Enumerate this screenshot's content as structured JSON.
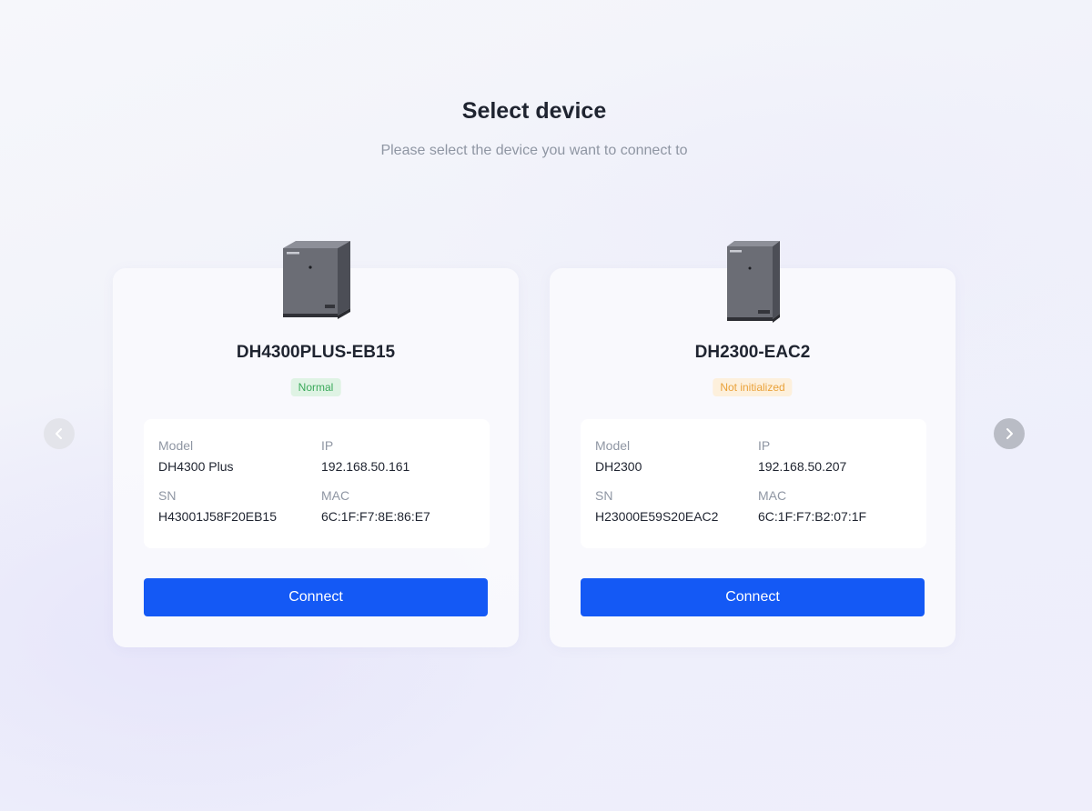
{
  "header": {
    "title": "Select device",
    "subtitle": "Please select the device you want to connect to"
  },
  "colors": {
    "primary": "#1459f5",
    "status_normal_bg": "#dff3e4",
    "status_normal_text": "#3aa95a",
    "status_warn_bg": "#fdf0dc",
    "status_warn_text": "#eaa23a"
  },
  "navigation": {
    "prev_icon": "chevron-left-icon",
    "next_icon": "chevron-right-icon"
  },
  "devices": [
    {
      "name": "DH4300PLUS-EB15",
      "status": "Normal",
      "labels": {
        "model": "Model",
        "ip": "IP",
        "sn": "SN",
        "mac": "MAC"
      },
      "model": "DH4300 Plus",
      "ip": "192.168.50.161",
      "sn": "H43001J58F20EB15",
      "mac": "6C:1F:F7:8E:86:E7",
      "connect_label": "Connect"
    },
    {
      "name": "DH2300-EAC2",
      "status": "Not initialized",
      "labels": {
        "model": "Model",
        "ip": "IP",
        "sn": "SN",
        "mac": "MAC"
      },
      "model": "DH2300",
      "ip": "192.168.50.207",
      "sn": "H23000E59S20EAC2",
      "mac": "6C:1F:F7:B2:07:1F",
      "connect_label": "Connect"
    }
  ]
}
